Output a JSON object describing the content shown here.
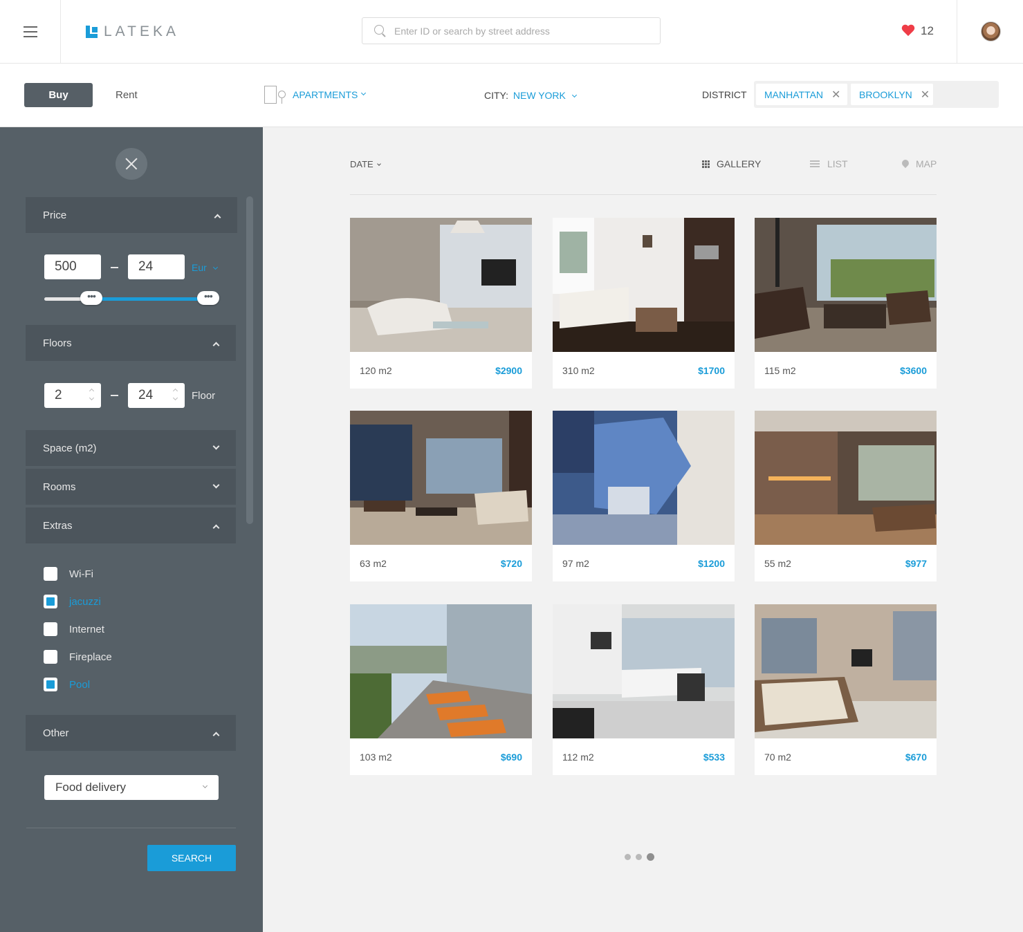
{
  "header": {
    "logo_text": "LATEKA",
    "search_placeholder": "Enter ID or search by street address",
    "favorites_count": "12"
  },
  "filters": {
    "buy_label": "Buy",
    "rent_label": "Rent",
    "property_type": "APARTMENTS",
    "city_label": "CITY:",
    "city_value": "NEW YORK",
    "district_label": "DISTRICT",
    "districts": [
      "MANHATTAN",
      "BROOKLYN"
    ]
  },
  "sidebar": {
    "price": {
      "label": "Price",
      "min": "500",
      "max": "24",
      "currency": "Eur",
      "slider_low_fraction": 0.27,
      "slider_high_fraction": 0.94
    },
    "floors": {
      "label": "Floors",
      "min": "2",
      "max": "24",
      "unit_label": "Floor"
    },
    "space_label": "Space (m2)",
    "rooms_label": "Rooms",
    "extras": {
      "label": "Extras",
      "items": [
        {
          "label": "Wi-Fi",
          "checked": false
        },
        {
          "label": "jacuzzi",
          "checked": true
        },
        {
          "label": "Internet",
          "checked": false
        },
        {
          "label": "Fireplace",
          "checked": false
        },
        {
          "label": "Pool",
          "checked": true
        }
      ]
    },
    "other": {
      "label": "Other",
      "selected": "Food delivery"
    },
    "search_button": "SEARCH"
  },
  "main": {
    "sort_label": "DATE",
    "views": {
      "gallery": "GALLERY",
      "list": "LIST",
      "map": "MAP"
    },
    "listings": [
      {
        "area": "120 m2",
        "price": "$2900"
      },
      {
        "area": "310 m2",
        "price": "$1700"
      },
      {
        "area": "115 m2",
        "price": "$3600"
      },
      {
        "area": "63 m2",
        "price": "$720"
      },
      {
        "area": "97 m2",
        "price": "$1200"
      },
      {
        "area": "55 m2",
        "price": "$977"
      },
      {
        "area": "103 m2",
        "price": "$690"
      },
      {
        "area": "112 m2",
        "price": "$533"
      },
      {
        "area": "70 m2",
        "price": "$670"
      }
    ],
    "pagination_active_page": 3,
    "pagination_total_dots": 3
  },
  "colors": {
    "accent": "#1a9cd8",
    "sidebar_bg": "#566067",
    "section_header_bg": "#4c555c",
    "favorite_heart": "#ef3d47"
  },
  "icons": [
    "menu-icon",
    "search-icon",
    "heart-icon",
    "avatar",
    "building-icon",
    "close-icon",
    "grid-icon",
    "list-icon",
    "map-pin-icon"
  ]
}
